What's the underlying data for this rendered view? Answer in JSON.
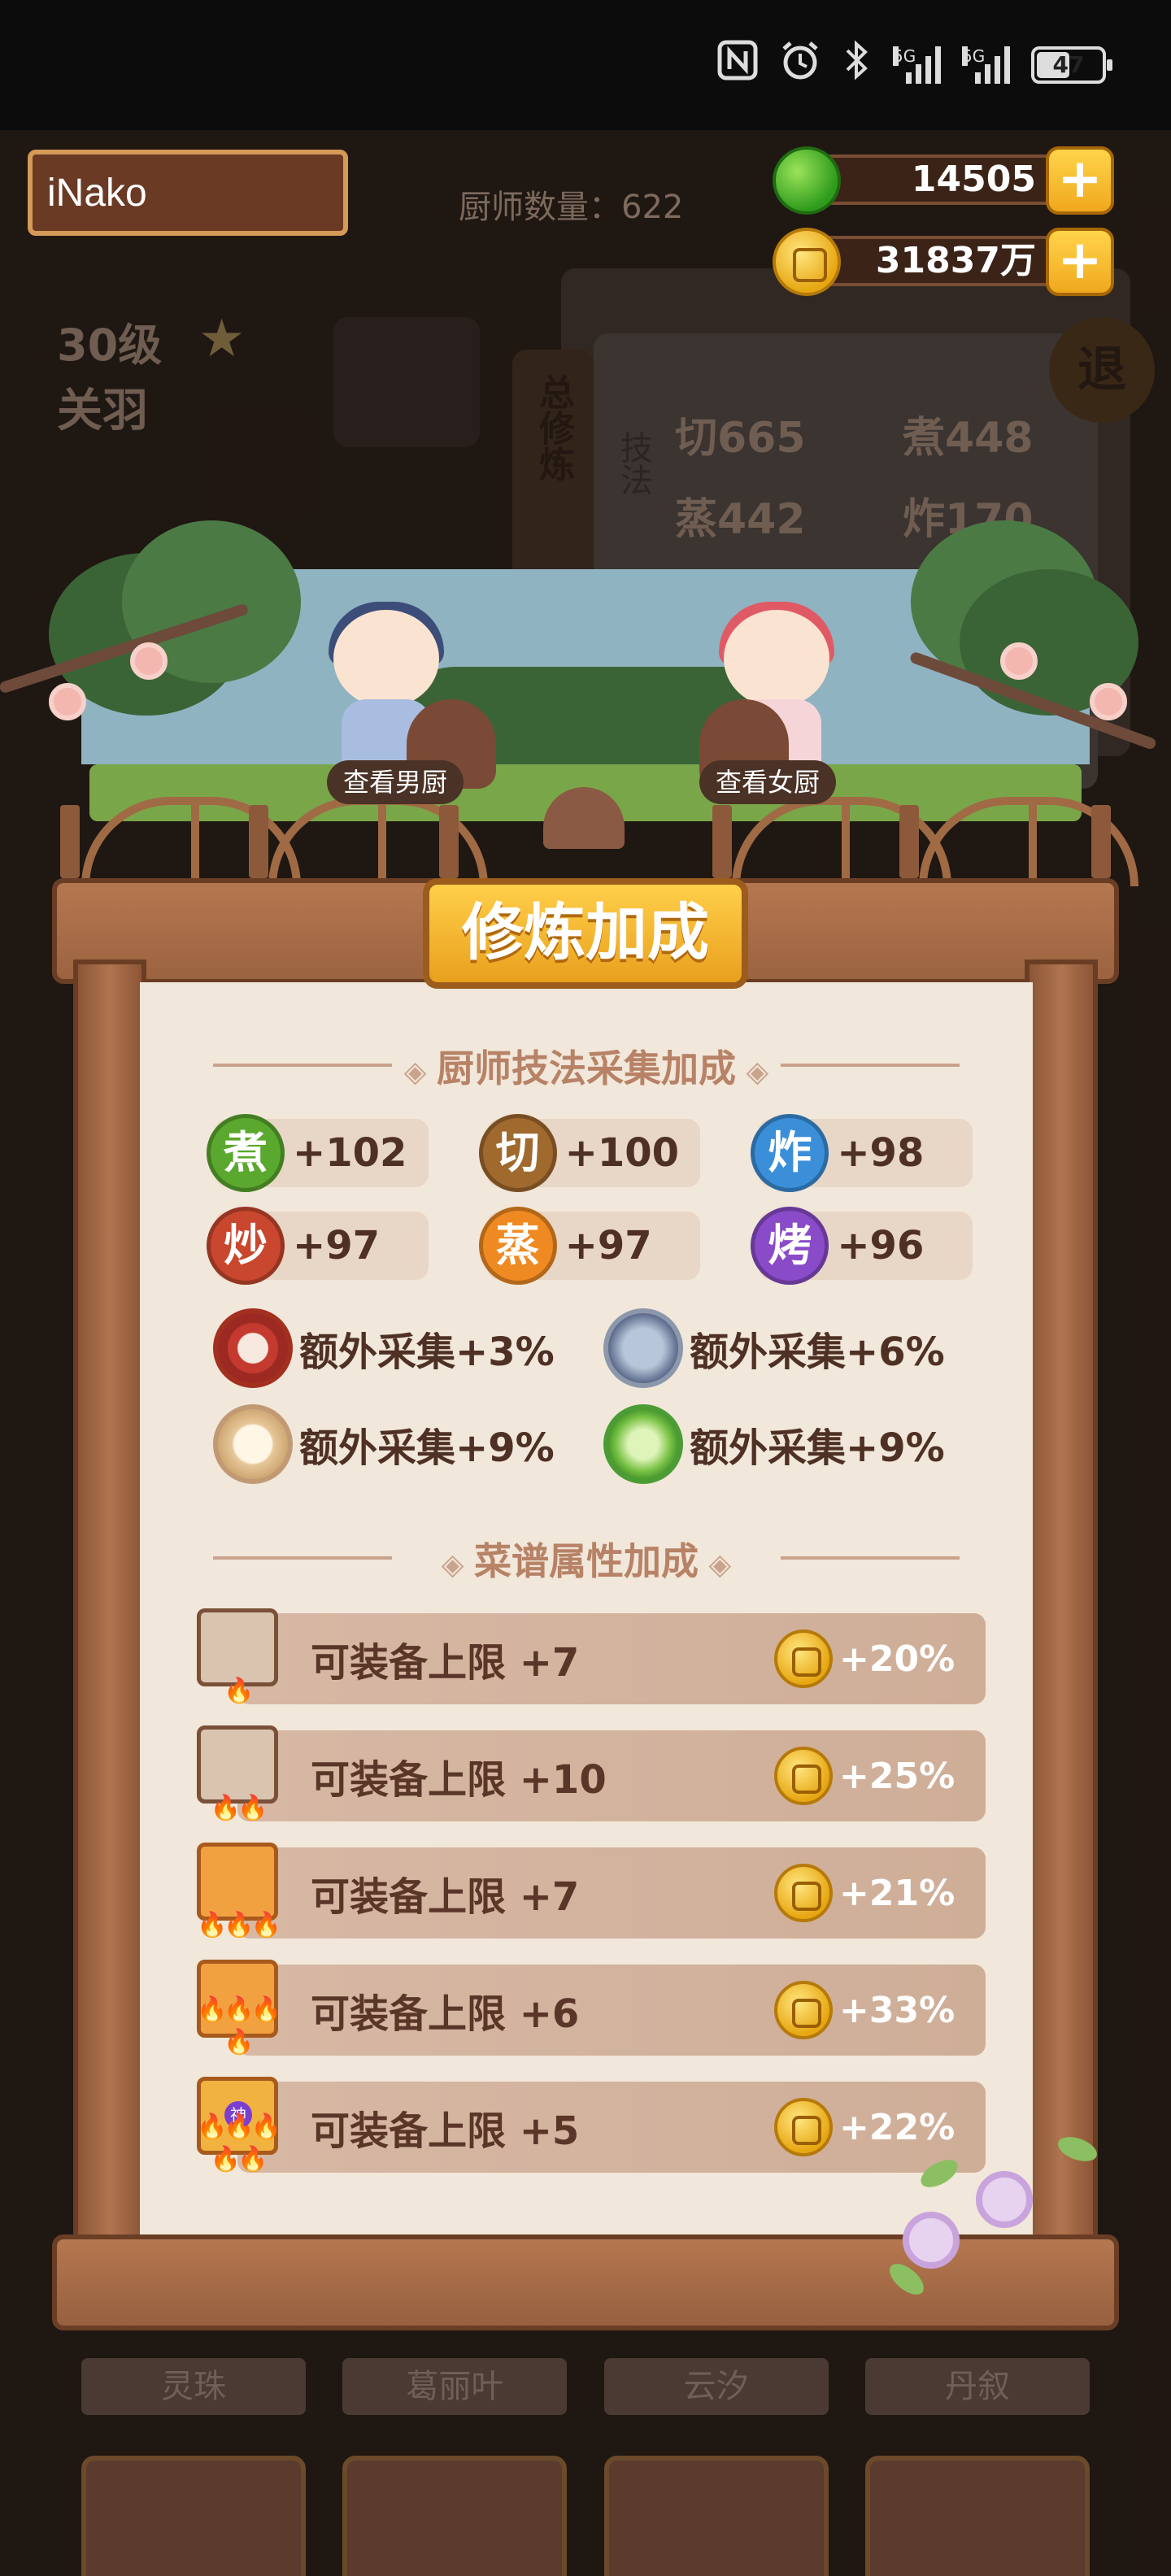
{
  "status_bar": {
    "network_label_1": "5G",
    "network_label_2": "5G",
    "battery_percent": "47",
    "icons": [
      "nfc-icon",
      "alarm-icon",
      "bluetooth-icon",
      "signal-icon",
      "signal-icon",
      "battery-icon"
    ]
  },
  "header": {
    "player_name": "iNako",
    "chef_count_label": "厨师数量：622",
    "green_currency": "14505",
    "gold_currency": "31837万"
  },
  "background": {
    "level": "30级",
    "chef_name": "关羽",
    "skills": [
      "切665",
      "煮448",
      "蒸442",
      "炸170"
    ],
    "side_tab": "总修炼",
    "side_label": "技法",
    "retreat_button": "退",
    "bottom_names": [
      "灵珠",
      "葛丽叶",
      "云汐",
      "丹叙"
    ]
  },
  "scene": {
    "view_male_button": "查看男厨",
    "view_female_button": "查看女厨"
  },
  "modal": {
    "title": "修炼加成",
    "skill_section_title": "厨师技法采集加成",
    "skills": [
      {
        "name": "煮",
        "value": "+102",
        "color": "#5aa82e"
      },
      {
        "name": "切",
        "value": "+100",
        "color": "#a0692e"
      },
      {
        "name": "炸",
        "value": "+98",
        "color": "#3b8fd8"
      },
      {
        "name": "炒",
        "value": "+97",
        "color": "#c9472e"
      },
      {
        "name": "蒸",
        "value": "+97",
        "color": "#ef8a22"
      },
      {
        "name": "烤",
        "value": "+96",
        "color": "#8a4bc8"
      }
    ],
    "extras": [
      {
        "icon": "meat-icon",
        "label": "额外采集+3%"
      },
      {
        "icon": "fish-icon",
        "label": "额外采集+6%"
      },
      {
        "icon": "bun-icon",
        "label": "额外采集+9%"
      },
      {
        "icon": "vegetable-icon",
        "label": "额外采集+9%"
      }
    ],
    "recipe_section_title": "菜谱属性加成",
    "recipes": [
      {
        "flames": 1,
        "tier": "plain",
        "label": "可装备上限 +7",
        "bonus": "+20%"
      },
      {
        "flames": 2,
        "tier": "plain",
        "label": "可装备上限 +10",
        "bonus": "+25%"
      },
      {
        "flames": 3,
        "tier": "gold",
        "label": "可装备上限 +7",
        "bonus": "+21%"
      },
      {
        "flames": 4,
        "tier": "gold",
        "label": "可装备上限 +6",
        "bonus": "+33%"
      },
      {
        "flames": 5,
        "tier": "divine",
        "label": "可装备上限 +5",
        "bonus": "+22%",
        "mark": "神"
      }
    ]
  }
}
